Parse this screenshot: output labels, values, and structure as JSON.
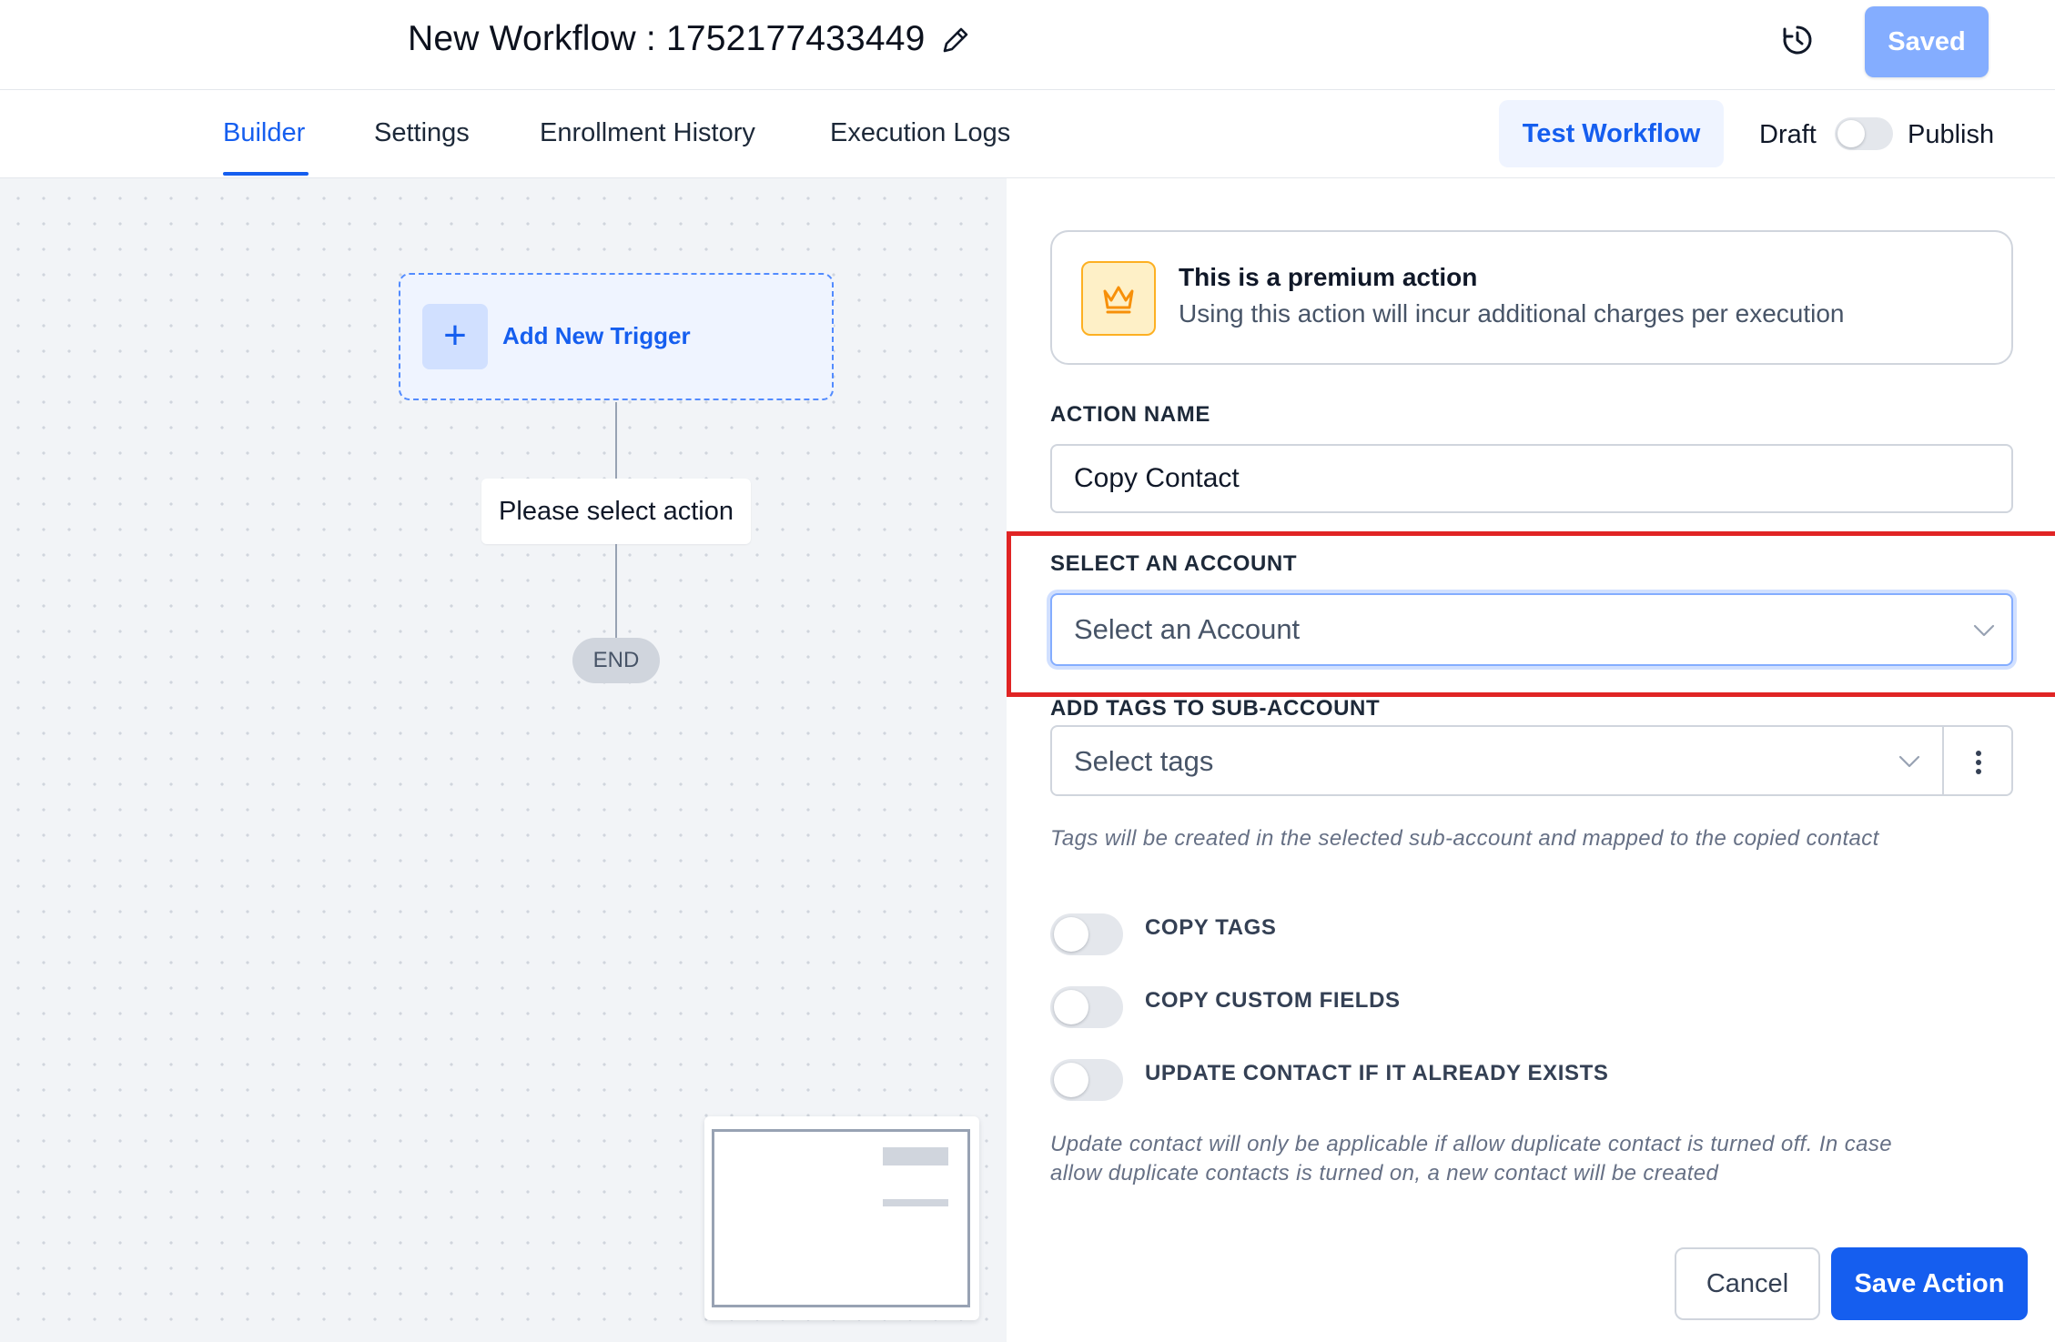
{
  "header": {
    "workflow_title": "New Workflow : 1752177433449",
    "edit_icon": "pencil-icon",
    "history_icon": "history-icon",
    "saved_label": "Saved"
  },
  "tabs": [
    {
      "label": "Builder",
      "active": true
    },
    {
      "label": "Settings",
      "active": false
    },
    {
      "label": "Enrollment History",
      "active": false
    },
    {
      "label": "Execution Logs",
      "active": false
    }
  ],
  "toolbar": {
    "test_workflow_label": "Test Workflow",
    "draft_label": "Draft",
    "publish_label": "Publish",
    "published": false
  },
  "canvas": {
    "trigger_label": "Add New Trigger",
    "action_placeholder": "Please select action",
    "end_label": "END"
  },
  "panel": {
    "premium": {
      "title": "This is a premium action",
      "description": "Using this action will incur additional charges per execution",
      "icon": "crown-icon"
    },
    "action_name": {
      "label": "ACTION NAME",
      "value": "Copy Contact"
    },
    "account": {
      "label": "SELECT AN ACCOUNT",
      "placeholder": "Select an Account"
    },
    "tags": {
      "label": "ADD TAGS TO SUB-ACCOUNT",
      "placeholder": "Select tags",
      "help": "Tags will be created in the selected sub-account and mapped to the copied contact"
    },
    "toggles": [
      {
        "label": "COPY TAGS",
        "on": false
      },
      {
        "label": "COPY CUSTOM FIELDS",
        "on": false
      },
      {
        "label": "UPDATE CONTACT IF IT ALREADY EXISTS",
        "on": false
      }
    ],
    "update_help_line1": "Update contact will only be applicable if allow duplicate contact is turned off. In case",
    "update_help_line2": "allow duplicate contacts is turned on, a new contact will be created",
    "cancel_label": "Cancel",
    "save_label": "Save Action"
  },
  "colors": {
    "primary": "#155eef",
    "saved_disabled": "#84adff",
    "highlight": "#e02424",
    "premium_yellow": "#fdb022"
  }
}
